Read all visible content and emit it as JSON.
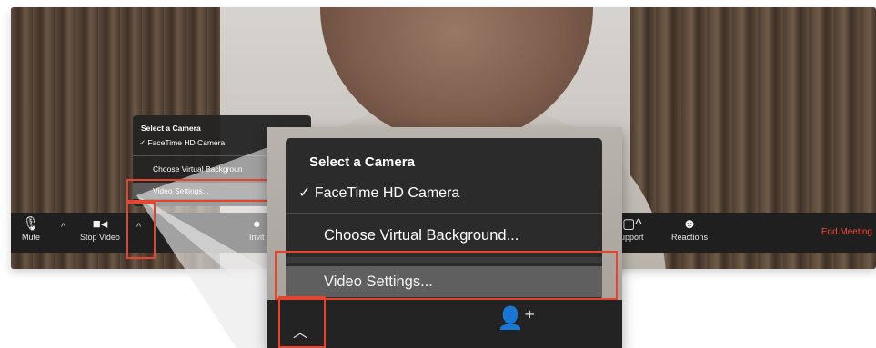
{
  "toolbar": {
    "mute_label": "Mute",
    "stop_video_label": "Stop Video",
    "invite_label": "Invit",
    "support_label": "upport",
    "reactions_label": "Reactions",
    "end_meeting_label": "End Meeting"
  },
  "camera_menu": {
    "heading": "Select a Camera",
    "selected_camera": "✓ FaceTime HD Camera",
    "virtual_background": "Choose Virtual Background...",
    "video_settings": "Video Settings..."
  },
  "small_menu": {
    "virtual_background": "Choose Virtual Backgroun",
    "video_settings": "Video Settings..."
  },
  "colors": {
    "highlight": "#e5452f",
    "end_meeting": "#e84a3c",
    "toolbar_bg": "#1f1f1f",
    "menu_bg": "#2b2b2b"
  }
}
